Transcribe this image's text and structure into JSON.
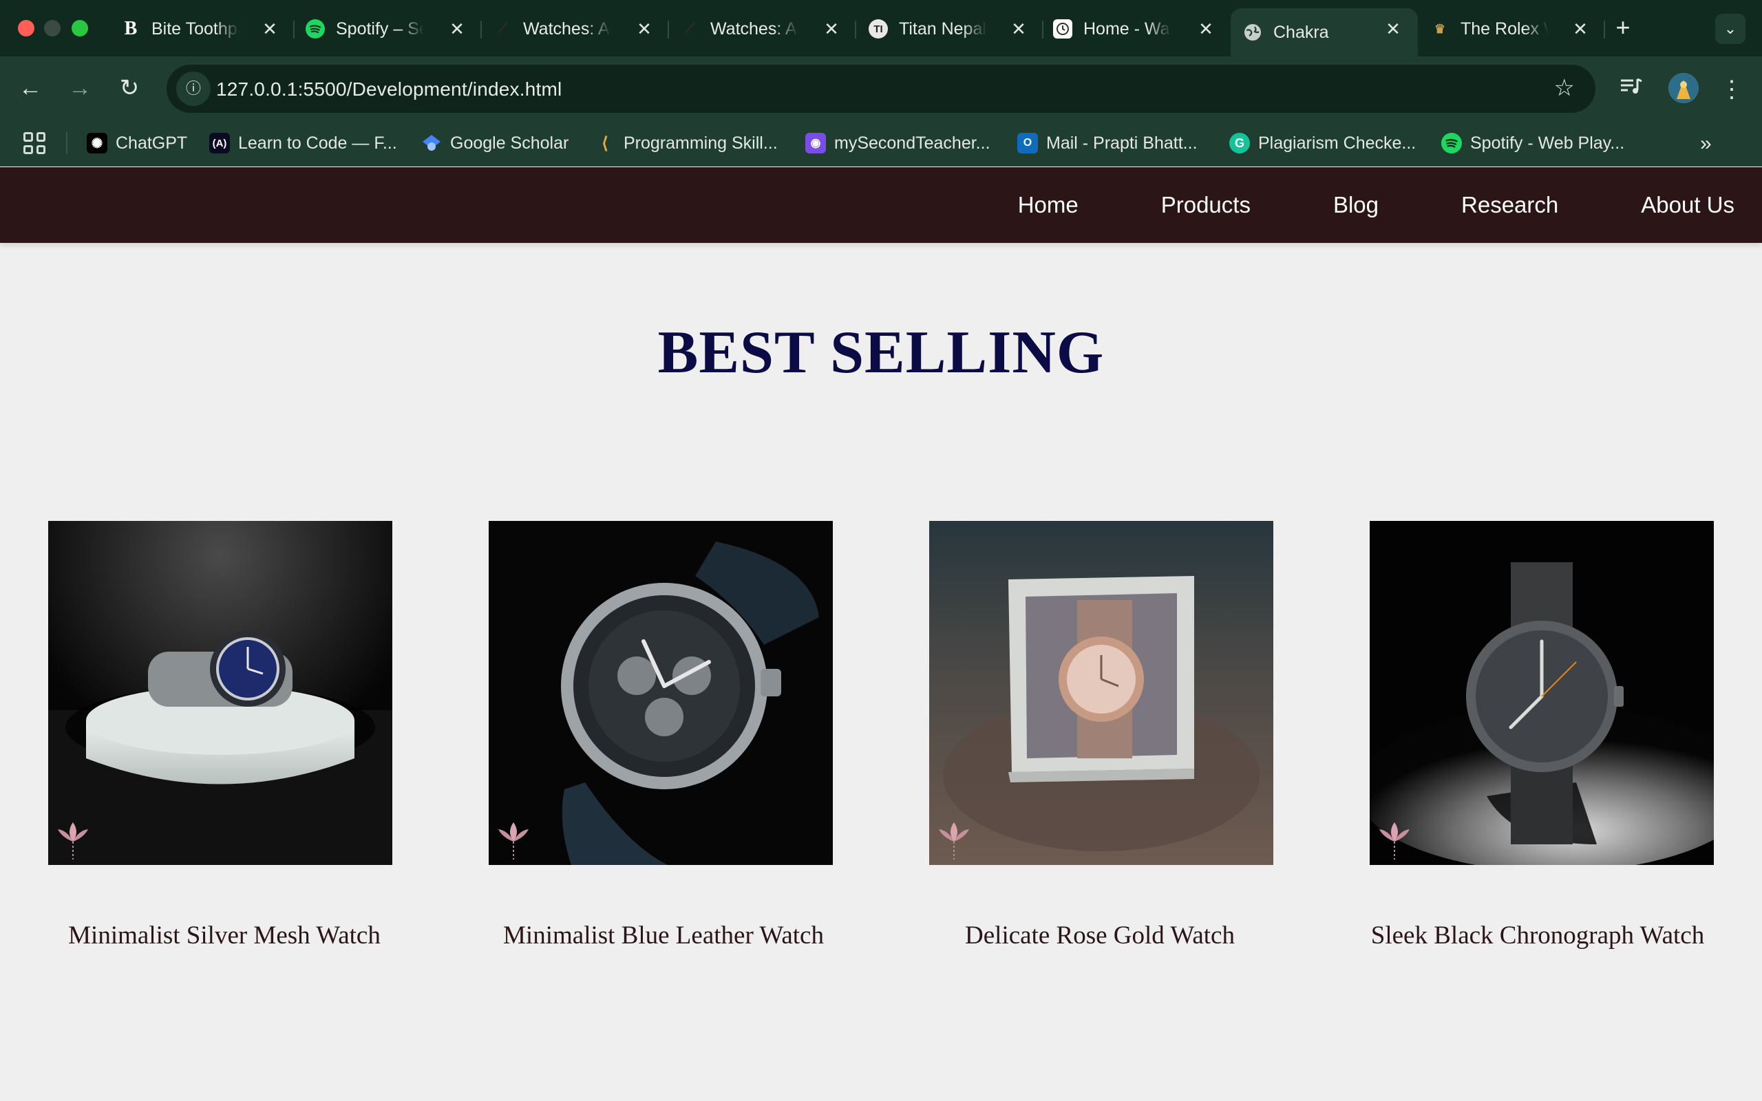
{
  "browser": {
    "tabs": [
      {
        "title": "Bite Toothpaste",
        "favicon": "bold-b-icon"
      },
      {
        "title": "Spotify – Search",
        "favicon": "spotify-icon"
      },
      {
        "title": "Watches: All",
        "favicon": "watch-brand-icon"
      },
      {
        "title": "Watches: All",
        "favicon": "watch-brand-icon"
      },
      {
        "title": "Titan Nepal",
        "favicon": "titan-icon"
      },
      {
        "title": "Home - Watch",
        "favicon": "clock-icon"
      },
      {
        "title": "Chakra",
        "favicon": "globe-icon",
        "active": true
      },
      {
        "title": "The Rolex Watch",
        "favicon": "rolex-crown-icon"
      }
    ],
    "url": "127.0.0.1:5500/Development/index.html",
    "bookmarks": [
      {
        "label": "ChatGPT",
        "icon": "chatgpt-icon"
      },
      {
        "label": "Learn to Code — F...",
        "icon": "freecodecamp-icon"
      },
      {
        "label": "Google Scholar",
        "icon": "scholar-icon"
      },
      {
        "label": "Programming Skill...",
        "icon": "programming-icon"
      },
      {
        "label": "mySecondTeacher...",
        "icon": "msteacher-icon"
      },
      {
        "label": "Mail - Prapti Bhatt...",
        "icon": "outlook-icon"
      },
      {
        "label": "Plagiarism Checke...",
        "icon": "grammarly-icon"
      },
      {
        "label": "Spotify - Web Play...",
        "icon": "spotify-icon"
      }
    ]
  },
  "site": {
    "nav": [
      "Home",
      "Products",
      "Blog",
      "Research",
      "About Us"
    ],
    "heading": "BEST SELLING",
    "products": [
      {
        "name": "Minimalist Silver Mesh Watch",
        "image": "silver-watch-on-pedestal"
      },
      {
        "name": "Minimalist Blue Leather Watch",
        "image": "chronograph-blue-leather"
      },
      {
        "name": "Delicate Rose Gold Watch",
        "image": "rose-gold-watch-in-box"
      },
      {
        "name": "Sleek Black Chronograph Watch",
        "image": "black-mesh-watch-spotlight"
      }
    ]
  },
  "colors": {
    "tabstrip": "#112a20",
    "toolbar": "#1f3d31",
    "site_nav": "#2c1517",
    "heading": "#0b0b45",
    "page_bg": "#efefef"
  }
}
